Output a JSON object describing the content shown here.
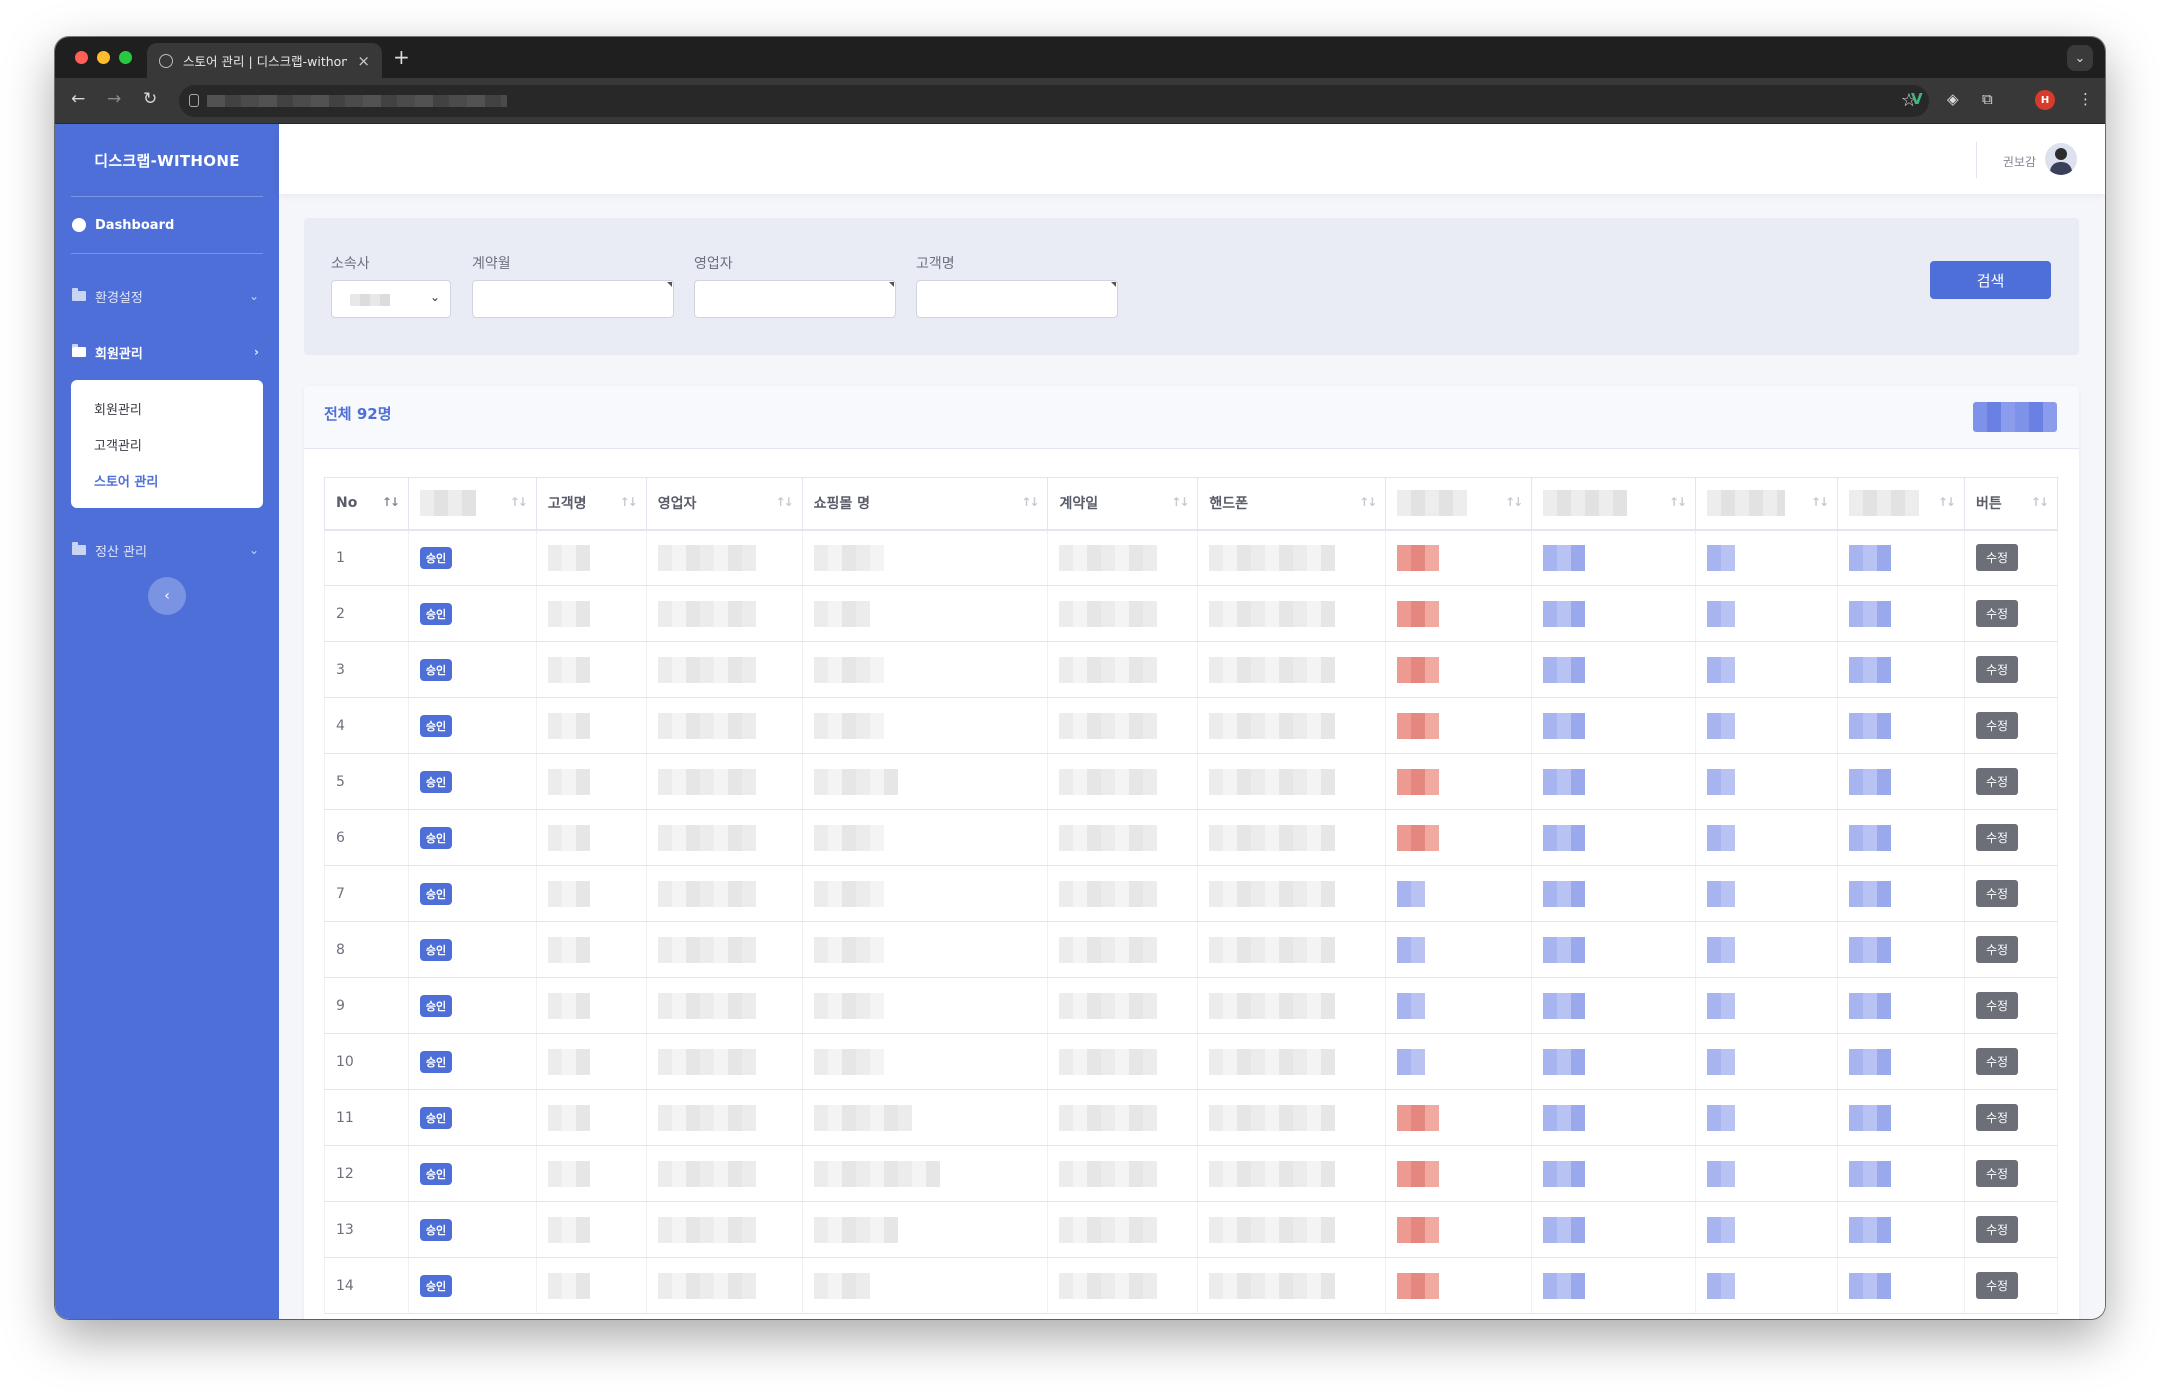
{
  "browser": {
    "tab_title": "스토어 관리 | 디스크랩-withone",
    "profile_initial": "H"
  },
  "sidebar": {
    "brand": "디스크랩-WITHONE",
    "dashboard": "Dashboard",
    "menu_settings": "환경설정",
    "menu_members": "회원관리",
    "sub_items": [
      "회원관리",
      "고객관리",
      "스토어 관리"
    ],
    "menu_settlement": "정산 관리"
  },
  "topbar": {
    "username": "권보감"
  },
  "filter": {
    "label_company": "소속사",
    "label_month": "계약월",
    "label_sales": "영업자",
    "label_customer": "고객명",
    "search_label": "검색"
  },
  "table": {
    "total_label": "전체 92명",
    "headers": [
      "No",
      "",
      "고객명",
      "영업자",
      "쇼핑몰 명",
      "계약일",
      "핸드폰",
      "",
      "",
      "",
      "",
      "버튼"
    ],
    "rows": [
      {
        "no": "1",
        "status": "승인",
        "flag": "red"
      },
      {
        "no": "2",
        "status": "승인",
        "flag": "red"
      },
      {
        "no": "3",
        "status": "승인",
        "flag": "red"
      },
      {
        "no": "4",
        "status": "승인",
        "flag": "red"
      },
      {
        "no": "5",
        "status": "승인",
        "flag": "red"
      },
      {
        "no": "6",
        "status": "승인",
        "flag": "red"
      },
      {
        "no": "7",
        "status": "승인",
        "flag": "blue"
      },
      {
        "no": "8",
        "status": "승인",
        "flag": "blue"
      },
      {
        "no": "9",
        "status": "승인",
        "flag": "blue"
      },
      {
        "no": "10",
        "status": "승인",
        "flag": "blue"
      },
      {
        "no": "11",
        "status": "승인",
        "flag": "red"
      },
      {
        "no": "12",
        "status": "승인",
        "flag": "red"
      },
      {
        "no": "13",
        "status": "승인",
        "flag": "red"
      },
      {
        "no": "14",
        "status": "승인",
        "flag": "red"
      }
    ],
    "edit_label": "수정"
  }
}
